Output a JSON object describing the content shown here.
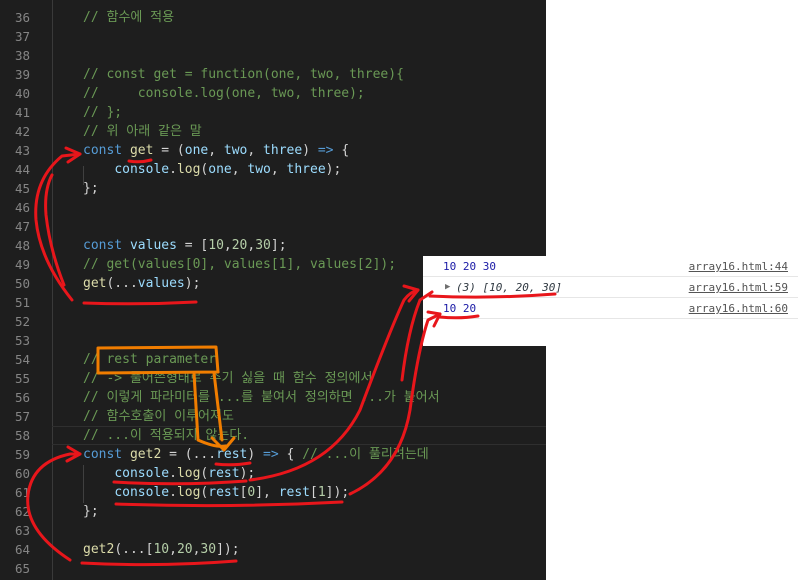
{
  "editor": {
    "lines": [
      {
        "num": "36",
        "tokens": [
          {
            "t": "// 함수에 적용",
            "c": "comment"
          }
        ]
      },
      {
        "num": "37",
        "tokens": []
      },
      {
        "num": "38",
        "tokens": []
      },
      {
        "num": "39",
        "tokens": [
          {
            "t": "// const get = function(one, two, three){",
            "c": "comment"
          }
        ]
      },
      {
        "num": "40",
        "tokens": [
          {
            "t": "//     console.log(one, two, three);",
            "c": "comment"
          }
        ]
      },
      {
        "num": "41",
        "tokens": [
          {
            "t": "// };",
            "c": "comment"
          }
        ]
      },
      {
        "num": "42",
        "tokens": [
          {
            "t": "// 위 아래 같은 말",
            "c": "comment"
          }
        ]
      },
      {
        "num": "43",
        "tokens": [
          {
            "t": "const ",
            "c": "kw"
          },
          {
            "t": "get",
            "c": "fn"
          },
          {
            "t": " = (",
            "c": "op"
          },
          {
            "t": "one",
            "c": "var"
          },
          {
            "t": ", ",
            "c": "op"
          },
          {
            "t": "two",
            "c": "var"
          },
          {
            "t": ", ",
            "c": "op"
          },
          {
            "t": "three",
            "c": "var"
          },
          {
            "t": ") ",
            "c": "op"
          },
          {
            "t": "=>",
            "c": "kw"
          },
          {
            "t": " {",
            "c": "op"
          }
        ]
      },
      {
        "num": "44",
        "tokens": [
          {
            "t": "    ",
            "c": "op"
          },
          {
            "t": "console",
            "c": "var"
          },
          {
            "t": ".",
            "c": "op"
          },
          {
            "t": "log",
            "c": "fn"
          },
          {
            "t": "(",
            "c": "op"
          },
          {
            "t": "one",
            "c": "var"
          },
          {
            "t": ", ",
            "c": "op"
          },
          {
            "t": "two",
            "c": "var"
          },
          {
            "t": ", ",
            "c": "op"
          },
          {
            "t": "three",
            "c": "var"
          },
          {
            "t": ");",
            "c": "op"
          }
        ]
      },
      {
        "num": "45",
        "tokens": [
          {
            "t": "};",
            "c": "op"
          }
        ]
      },
      {
        "num": "46",
        "tokens": []
      },
      {
        "num": "47",
        "tokens": []
      },
      {
        "num": "48",
        "tokens": [
          {
            "t": "const ",
            "c": "kw"
          },
          {
            "t": "values",
            "c": "var"
          },
          {
            "t": " = [",
            "c": "op"
          },
          {
            "t": "10",
            "c": "num"
          },
          {
            "t": ",",
            "c": "op"
          },
          {
            "t": "20",
            "c": "num"
          },
          {
            "t": ",",
            "c": "op"
          },
          {
            "t": "30",
            "c": "num"
          },
          {
            "t": "];",
            "c": "op"
          }
        ]
      },
      {
        "num": "49",
        "tokens": [
          {
            "t": "// get(values[0], values[1], values[2]);",
            "c": "comment"
          }
        ]
      },
      {
        "num": "50",
        "tokens": [
          {
            "t": "get",
            "c": "fn"
          },
          {
            "t": "(...",
            "c": "op"
          },
          {
            "t": "values",
            "c": "var"
          },
          {
            "t": ");",
            "c": "op"
          }
        ]
      },
      {
        "num": "51",
        "tokens": []
      },
      {
        "num": "52",
        "tokens": []
      },
      {
        "num": "53",
        "tokens": []
      },
      {
        "num": "54",
        "tokens": [
          {
            "t": "// rest parameter",
            "c": "comment"
          }
        ]
      },
      {
        "num": "55",
        "tokens": [
          {
            "t": "// -> 풀어쓴형태로 주기 싫을 때 함수 정의에서",
            "c": "comment"
          }
        ]
      },
      {
        "num": "56",
        "tokens": [
          {
            "t": "// 이렇게 파라미터를 ...를 붙여서 정의하면 ...가 붙어서",
            "c": "comment"
          }
        ]
      },
      {
        "num": "57",
        "tokens": [
          {
            "t": "// 함수호출이 이루어져도",
            "c": "comment"
          }
        ]
      },
      {
        "num": "58",
        "tokens": [
          {
            "t": "// ...이 적용되지 않는다.",
            "c": "comment"
          }
        ]
      },
      {
        "num": "59",
        "tokens": [
          {
            "t": "const ",
            "c": "kw"
          },
          {
            "t": "get2",
            "c": "fn"
          },
          {
            "t": " = (...",
            "c": "op"
          },
          {
            "t": "rest",
            "c": "var"
          },
          {
            "t": ") ",
            "c": "op"
          },
          {
            "t": "=>",
            "c": "kw"
          },
          {
            "t": " { ",
            "c": "op"
          },
          {
            "t": "// ...이 풀리려는데",
            "c": "comment"
          }
        ]
      },
      {
        "num": "60",
        "tokens": [
          {
            "t": "    ",
            "c": "op"
          },
          {
            "t": "console",
            "c": "var"
          },
          {
            "t": ".",
            "c": "op"
          },
          {
            "t": "log",
            "c": "fn"
          },
          {
            "t": "(",
            "c": "op"
          },
          {
            "t": "rest",
            "c": "var"
          },
          {
            "t": ");",
            "c": "op"
          }
        ]
      },
      {
        "num": "61",
        "tokens": [
          {
            "t": "    ",
            "c": "op"
          },
          {
            "t": "console",
            "c": "var"
          },
          {
            "t": ".",
            "c": "op"
          },
          {
            "t": "log",
            "c": "fn"
          },
          {
            "t": "(",
            "c": "op"
          },
          {
            "t": "rest",
            "c": "var"
          },
          {
            "t": "[",
            "c": "op"
          },
          {
            "t": "0",
            "c": "num"
          },
          {
            "t": "], ",
            "c": "op"
          },
          {
            "t": "rest",
            "c": "var"
          },
          {
            "t": "[",
            "c": "op"
          },
          {
            "t": "1",
            "c": "num"
          },
          {
            "t": "]);",
            "c": "op"
          }
        ]
      },
      {
        "num": "62",
        "tokens": [
          {
            "t": "};",
            "c": "op"
          }
        ]
      },
      {
        "num": "63",
        "tokens": []
      },
      {
        "num": "64",
        "tokens": [
          {
            "t": "get2",
            "c": "fn"
          },
          {
            "t": "(...[",
            "c": "op"
          },
          {
            "t": "10",
            "c": "num"
          },
          {
            "t": ",",
            "c": "op"
          },
          {
            "t": "20",
            "c": "num"
          },
          {
            "t": ",",
            "c": "op"
          },
          {
            "t": "30",
            "c": "num"
          },
          {
            "t": "]);",
            "c": "op"
          }
        ]
      },
      {
        "num": "65",
        "tokens": []
      }
    ]
  },
  "console": {
    "rows": [
      {
        "value": "10 20 30",
        "source": "array16.html:44",
        "expandable": false
      },
      {
        "value": "(3) [10, 20, 30]",
        "source": "array16.html:59",
        "expandable": true,
        "arrow": "▶"
      },
      {
        "value": "10 20",
        "source": "array16.html:60",
        "expandable": false
      }
    ]
  },
  "colors": {
    "editor_bg": "#1e1e1e",
    "comment": "#6a9955",
    "keyword": "#569cd6",
    "variable": "#9cdcfe",
    "function": "#dcdcaa",
    "number": "#b5cea8",
    "annotation_red": "#e8161b",
    "annotation_orange": "#f07d00"
  }
}
